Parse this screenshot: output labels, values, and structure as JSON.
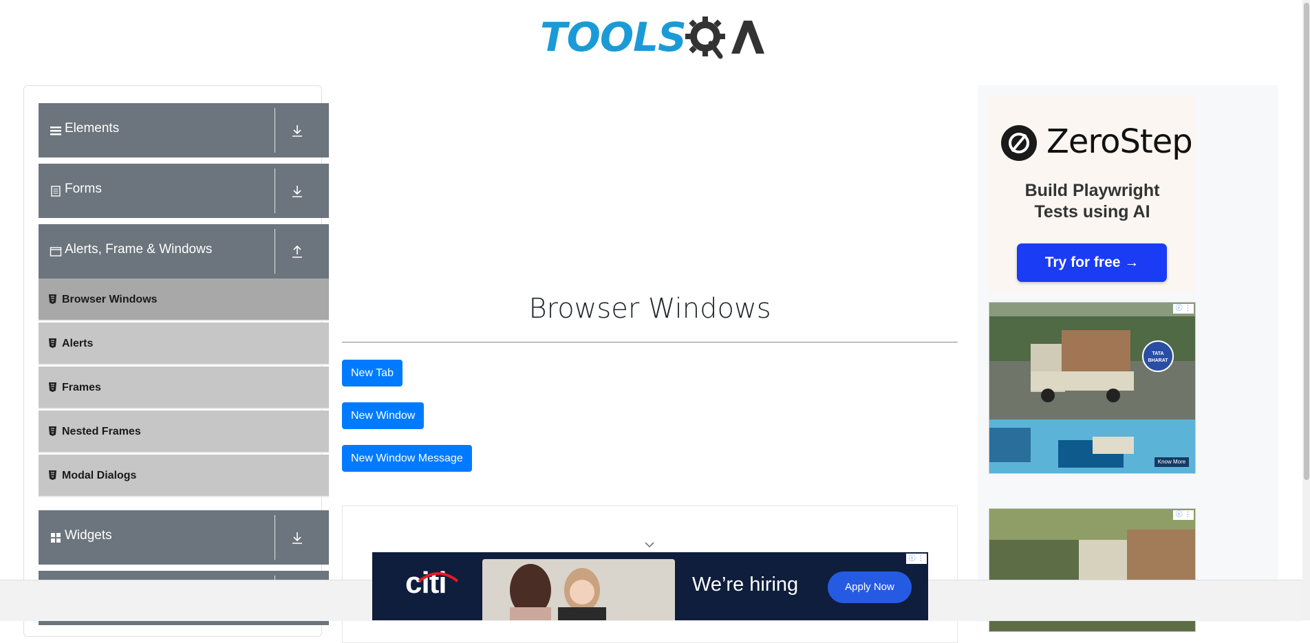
{
  "header": {
    "logo_text": "TOOLS",
    "logo_suffix": "QA"
  },
  "sidebar": {
    "groups": [
      {
        "label": "Elements",
        "icon": "list-icon",
        "arrow": "download-icon"
      },
      {
        "label": "Forms",
        "icon": "document-icon",
        "arrow": "download-icon"
      },
      {
        "label": "Alerts, Frame & Windows",
        "icon": "window-icon",
        "arrow": "upload-icon"
      },
      {
        "label": "Widgets",
        "icon": "widgets-icon",
        "arrow": "download-icon"
      }
    ],
    "items": [
      {
        "label": "Browser Windows",
        "active": true
      },
      {
        "label": "Alerts",
        "active": false
      },
      {
        "label": "Frames",
        "active": false
      },
      {
        "label": "Nested Frames",
        "active": false
      },
      {
        "label": "Modal Dialogs",
        "active": false
      }
    ]
  },
  "main": {
    "title": "Browser Windows",
    "buttons": [
      "New Tab",
      "New Window",
      "New Window Message"
    ]
  },
  "ads": {
    "zerostep": {
      "brand": "ZeroStep",
      "tagline_line1": "Build Playwright",
      "tagline_line2": "Tests using AI",
      "cta": "Try for free →"
    },
    "tata": {
      "cta": "Know More"
    },
    "citi": {
      "brand": "citi",
      "message": "We’re hiring",
      "cta": "Apply Now"
    }
  },
  "colors": {
    "nav_header": "#6c757d",
    "nav_item": "#c6c6c6",
    "nav_item_active": "#a8a8a8",
    "primary_button": "#007bff",
    "logo_blue": "#1a9bd7"
  }
}
